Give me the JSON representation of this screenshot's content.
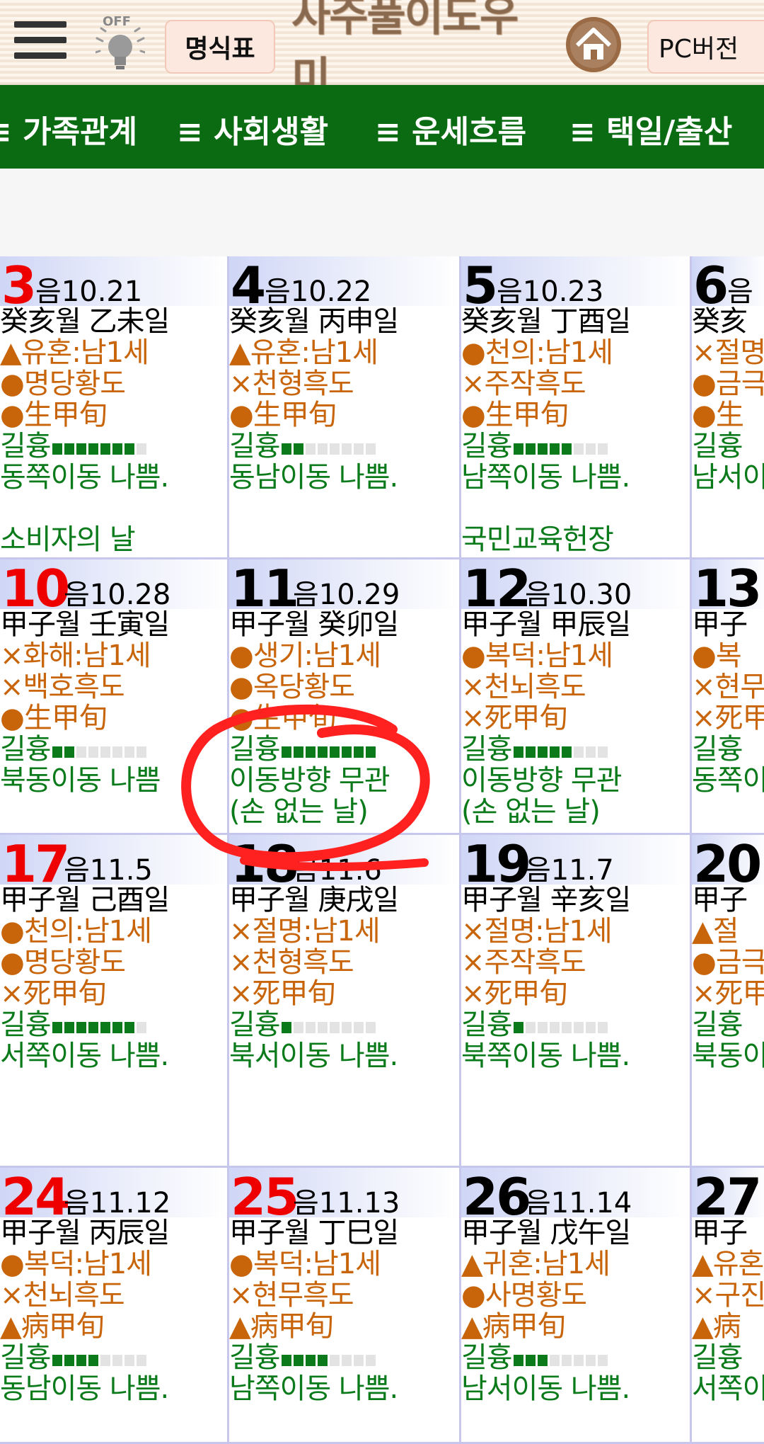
{
  "topbar": {
    "light_label": "OFF",
    "chart_button": "명식표",
    "logo": "사주풀이도우미",
    "pc_button": "PC버전"
  },
  "nav": [
    "≡ 가족관계",
    "≡ 사회생활",
    "≡ 운세흐름",
    "≡ 택일/출산"
  ],
  "colors": {
    "nav_bg": "#0b6b12",
    "sunday_red": "#ee0000",
    "good_green": "#0b7a1b",
    "note_orange": "#c8640a"
  },
  "calendar": {
    "rows": [
      [
        {
          "day": "3",
          "lunar": "음10.21",
          "ganji": "癸亥월 乙未일",
          "l1": "▲유혼:남1세",
          "l2": "●명당황도",
          "l3": "●生甲旬",
          "luck": "길흉",
          "luck_level": 7,
          "dir": "동쪽이동 나쁨.",
          "extra": "",
          "note": "소비자의 날",
          "red": true
        },
        {
          "day": "4",
          "lunar": "음10.22",
          "ganji": "癸亥월 丙申일",
          "l1": "▲유혼:남1세",
          "l2": "×천형흑도",
          "l3": "●生甲旬",
          "luck": "길흉",
          "luck_level": 2,
          "dir": "동남이동 나쁨.",
          "extra": "",
          "note": "",
          "red": false
        },
        {
          "day": "5",
          "lunar": "음10.23",
          "ganji": "癸亥월 丁酉일",
          "l1": "●천의:남1세",
          "l2": "×주작흑도",
          "l3": "●生甲旬",
          "luck": "길흉",
          "luck_level": 5,
          "dir": "남쪽이동 나쁨.",
          "extra": "",
          "note": "국민교육헌장",
          "red": false
        },
        {
          "day": "6",
          "lunar": "음",
          "ganji": "癸亥",
          "l1": "×절명",
          "l2": "●금극",
          "l3": "●生",
          "luck": "길흉",
          "luck_level": 0,
          "dir": "남서이",
          "extra": "",
          "note": "",
          "red": false
        }
      ],
      [
        {
          "day": "10",
          "lunar": "음10.28",
          "ganji": "甲子월 壬寅일",
          "l1": "×화해:남1세",
          "l2": "×백호흑도",
          "l3": "●生甲旬",
          "luck": "길흉",
          "luck_level": 2,
          "dir": "북동이동 나쁨",
          "extra": "",
          "note": "",
          "red": true
        },
        {
          "day": "11",
          "lunar": "음10.29",
          "ganji": "甲子월 癸卯일",
          "l1": "●생기:남1세",
          "l2": "●옥당황도",
          "l3": "●生甲旬",
          "luck": "길흉",
          "luck_level": 8,
          "dir": "이동방향 무관",
          "extra": "(손 없는 날)",
          "note": "",
          "red": false
        },
        {
          "day": "12",
          "lunar": "음10.30",
          "ganji": "甲子월 甲辰일",
          "l1": "●복덕:남1세",
          "l2": "×천뇌흑도",
          "l3": "×死甲旬",
          "luck": "길흉",
          "luck_level": 5,
          "dir": "이동방향 무관",
          "extra": "(손 없는 날)",
          "note": "",
          "red": false
        },
        {
          "day": "13",
          "lunar": "",
          "ganji": "甲子",
          "l1": "●복",
          "l2": "×현무",
          "l3": "×死甲",
          "luck": "길흉",
          "luck_level": 0,
          "dir": "동쪽이",
          "extra": "",
          "note": "",
          "red": false
        }
      ],
      [
        {
          "day": "17",
          "lunar": "음11.5",
          "ganji": "甲子월 己酉일",
          "l1": "●천의:남1세",
          "l2": "●명당황도",
          "l3": "×死甲旬",
          "luck": "길흉",
          "luck_level": 7,
          "dir": "서쪽이동 나쁨.",
          "extra": "",
          "note": "",
          "red": true
        },
        {
          "day": "18",
          "lunar": "음11.6",
          "ganji": "甲子월 庚戌일",
          "l1": "×절명:남1세",
          "l2": "×천형흑도",
          "l3": "×死甲旬",
          "luck": "길흉",
          "luck_level": 1,
          "dir": "북서이동 나쁨.",
          "extra": "",
          "note": "",
          "red": false
        },
        {
          "day": "19",
          "lunar": "음11.7",
          "ganji": "甲子월 辛亥일",
          "l1": "×절명:남1세",
          "l2": "×주작흑도",
          "l3": "×死甲旬",
          "luck": "길흉",
          "luck_level": 1,
          "dir": "북쪽이동 나쁨.",
          "extra": "",
          "note": "",
          "red": false
        },
        {
          "day": "20",
          "lunar": "",
          "ganji": "甲子",
          "l1": "▲절",
          "l2": "●금극",
          "l3": "×死甲",
          "luck": "길흉",
          "luck_level": 0,
          "dir": "북동이",
          "extra": "",
          "note": "",
          "red": false
        }
      ],
      [
        {
          "day": "24",
          "lunar": "음11.12",
          "ganji": "甲子월 丙辰일",
          "l1": "●복덕:남1세",
          "l2": "×천뇌흑도",
          "l3": "▲病甲旬",
          "luck": "길흉",
          "luck_level": 4,
          "dir": "동남이동 나쁨.",
          "extra": "",
          "note": "",
          "red": true
        },
        {
          "day": "25",
          "lunar": "음11.13",
          "ganji": "甲子월 丁巳일",
          "l1": "●복덕:남1세",
          "l2": "×현무흑도",
          "l3": "▲病甲旬",
          "luck": "길흉",
          "luck_level": 4,
          "dir": "남쪽이동 나쁨.",
          "extra": "",
          "note": "",
          "red": true
        },
        {
          "day": "26",
          "lunar": "음11.14",
          "ganji": "甲子월 戊午일",
          "l1": "▲귀혼:남1세",
          "l2": "●사명황도",
          "l3": "▲病甲旬",
          "luck": "길흉",
          "luck_level": 3,
          "dir": "남서이동 나쁨.",
          "extra": "",
          "note": "",
          "red": false
        },
        {
          "day": "27",
          "lunar": "",
          "ganji": "甲子",
          "l1": "▲유혼",
          "l2": "×구진",
          "l3": "▲病",
          "luck": "길흉",
          "luck_level": 0,
          "dir": "서쪽이",
          "extra": "",
          "note": "",
          "red": false
        }
      ]
    ]
  }
}
